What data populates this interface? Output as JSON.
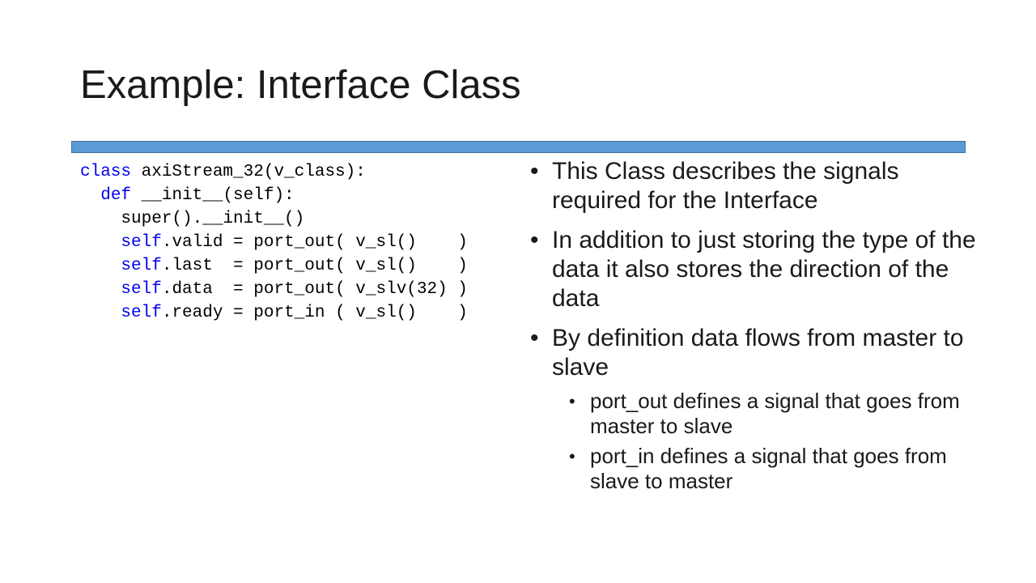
{
  "slide": {
    "title": "Example: Interface Class",
    "accent_bar_color": "#5b9bd5"
  },
  "code": {
    "keyword_color": "#0000ee",
    "lines": [
      {
        "indent": "",
        "kw": "class",
        "rest": " axiStream_32(v_class):"
      },
      {
        "indent": "  ",
        "kw": "def",
        "rest": " __init__(self):"
      },
      {
        "indent": "    ",
        "kw": "",
        "rest": "super().__init__()"
      },
      {
        "indent": "    ",
        "kw": "self",
        "rest": ".valid = port_out( v_sl()    )"
      },
      {
        "indent": "    ",
        "kw": "self",
        "rest": ".last  = port_out( v_sl()    )"
      },
      {
        "indent": "    ",
        "kw": "self",
        "rest": ".data  = port_out( v_slv(32) )"
      },
      {
        "indent": "    ",
        "kw": "self",
        "rest": ".ready = port_in ( v_sl()    )"
      }
    ]
  },
  "bullets": {
    "items": [
      {
        "text": "This Class describes the signals required for the Interface"
      },
      {
        "text": "In addition to just storing the type of the data it also stores the direction of the data"
      },
      {
        "text": "By definition data flows from master to slave",
        "sub": [
          {
            "text": "port_out defines a signal that goes from master to slave"
          },
          {
            "text": "port_in defines a signal that goes from slave to master"
          }
        ]
      }
    ]
  }
}
